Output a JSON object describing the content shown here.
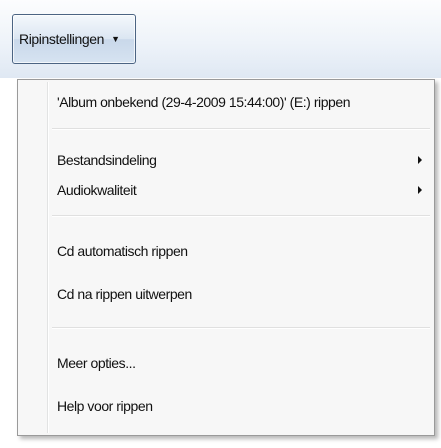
{
  "toolbar": {
    "rip_settings_label": "Ripinstellingen"
  },
  "menu": {
    "items": [
      {
        "label": "'Album onbekend (29-4-2009 15:44:00)' (E:) rippen"
      },
      {
        "label": "Bestandsindeling",
        "submenu": true
      },
      {
        "label": "Audiokwaliteit",
        "submenu": true
      },
      {
        "label": "Cd automatisch rippen"
      },
      {
        "label": "Cd na rippen uitwerpen"
      },
      {
        "label": "Meer opties..."
      },
      {
        "label": "Help voor rippen"
      }
    ]
  }
}
